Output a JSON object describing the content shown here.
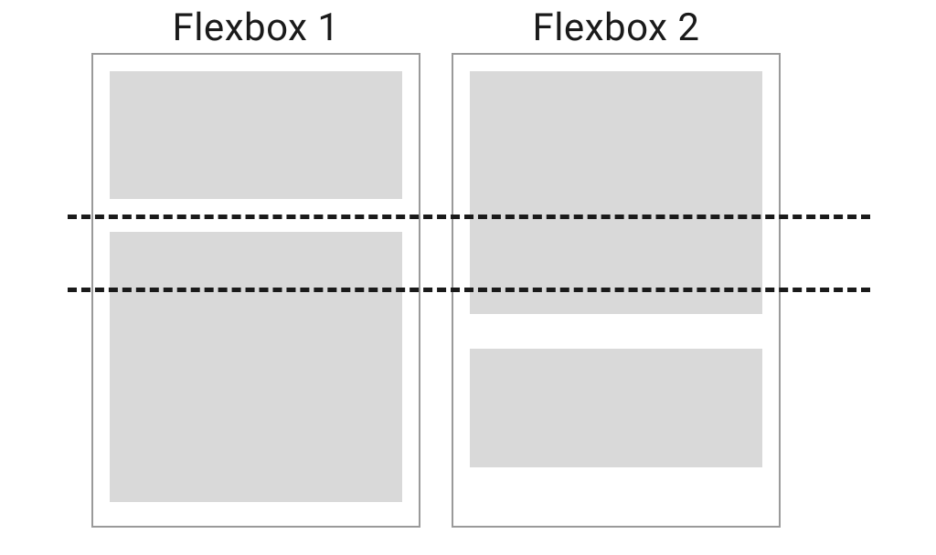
{
  "headings": {
    "left": "Flexbox 1",
    "right": "Flexbox 2"
  }
}
